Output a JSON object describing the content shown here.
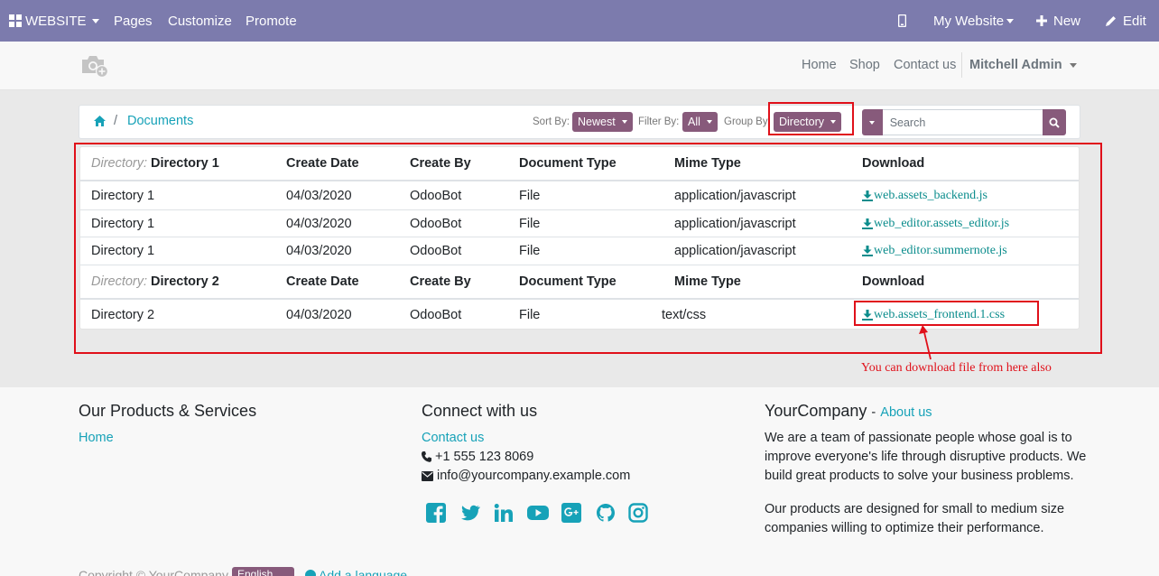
{
  "admin_bar": {
    "website_label": "WEBSITE",
    "pages_label": "Pages",
    "customize_label": "Customize",
    "promote_label": "Promote",
    "mobile_icon": "mobile-icon",
    "my_website_label": "My Website",
    "new_label": "New",
    "edit_label": "Edit"
  },
  "site_nav": {
    "logo_icon": "camera-plus-icon",
    "items": [
      "Home",
      "Shop",
      "Contact us"
    ],
    "user_label": "Mitchell Admin"
  },
  "breadcrumb": {
    "home_icon": "home-icon",
    "separator": "/",
    "current": "Documents"
  },
  "filters": {
    "sort_label": "Sort By:",
    "sort_value": "Newest",
    "filter_label": "Filter By:",
    "filter_value": "All",
    "group_label": "Group By",
    "group_value": "Directory"
  },
  "search": {
    "placeholder": "Search"
  },
  "table": {
    "group_prefix": "Directory:",
    "columns": [
      "Create Date",
      "Create By",
      "Document Type",
      "Mime Type",
      "Download"
    ],
    "groups": [
      {
        "name": "Directory 1",
        "rows": [
          {
            "directory": "Directory 1",
            "date": "04/03/2020",
            "by": "OdooBot",
            "type": "File",
            "mime": "application/javascript",
            "file": "web.assets_backend.js"
          },
          {
            "directory": "Directory 1",
            "date": "04/03/2020",
            "by": "OdooBot",
            "type": "File",
            "mime": "application/javascript",
            "file": "web_editor.assets_editor.js"
          },
          {
            "directory": "Directory 1",
            "date": "04/03/2020",
            "by": "OdooBot",
            "type": "File",
            "mime": "application/javascript",
            "file": "web_editor.summernote.js"
          }
        ]
      },
      {
        "name": "Directory 2",
        "rows": [
          {
            "directory": "Directory 2",
            "date": "04/03/2020",
            "by": "OdooBot",
            "type": "File",
            "mime": "text/css",
            "file": "web.assets_frontend.1.css"
          }
        ]
      }
    ]
  },
  "annotation": {
    "text": "You can download file from here also",
    "color": "#e0101a"
  },
  "footer": {
    "products_title": "Our Products & Services",
    "products_link": "Home",
    "connect_title": "Connect with us",
    "contact_link": "Contact us",
    "phone": "+1 555 123 8069",
    "email": "info@yourcompany.example.com",
    "social_icons": [
      "facebook-icon",
      "twitter-icon",
      "linkedin-icon",
      "youtube-icon",
      "google-plus-icon",
      "github-icon",
      "instagram-icon"
    ],
    "company_name": "YourCompany",
    "company_dash": "-",
    "about_link": "About us",
    "about_text_1": "We are a team of passionate people whose goal is to improve everyone's life through disruptive products. We build great products to solve your business problems.",
    "about_text_2": "Our products are designed for small to medium size companies willing to optimize their performance.",
    "copyright": "Copyright © YourCompany",
    "language": "English",
    "add_language": "Add a language"
  },
  "colors": {
    "admin_bar": "#7c7bad",
    "primary": "#875a7b",
    "link": "#17a2b8",
    "annotation": "#e0101a"
  }
}
